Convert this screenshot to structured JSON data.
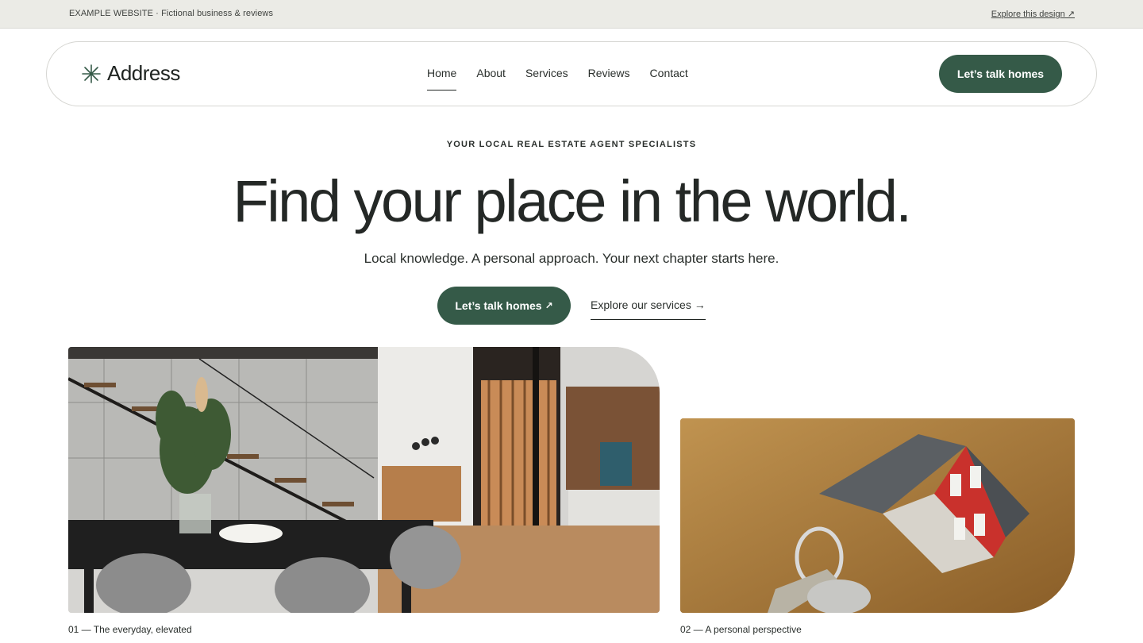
{
  "topbar": {
    "label": "EXAMPLE WEBSITE · Fictional business & reviews",
    "explore_link": "Explore this design ↗"
  },
  "brand": {
    "name": "Address",
    "icon": "asterisk-star-icon"
  },
  "nav": {
    "items": [
      {
        "label": "Home",
        "active": true
      },
      {
        "label": "About"
      },
      {
        "label": "Services"
      },
      {
        "label": "Reviews"
      },
      {
        "label": "Contact"
      }
    ],
    "cta": "Let’s talk homes"
  },
  "hero": {
    "eyebrow": "YOUR LOCAL REAL ESTATE AGENT SPECIALISTS",
    "headline": "Find your place in the world.",
    "subhead": "Local knowledge. A personal approach. Your next chapter starts here.",
    "primary_cta": "Let’s talk homes",
    "primary_cta_icon": "↗",
    "secondary_link": "Explore our services →"
  },
  "gallery": [
    {
      "caption": "01 — The everyday, elevated",
      "image": "modern-interior-dining-stairs"
    },
    {
      "caption": "02 — A personal perspective",
      "image": "toy-house-with-keys"
    }
  ],
  "colors": {
    "accent": "#355a48",
    "topbar_bg": "#ebebe6",
    "text": "#1f2421"
  }
}
